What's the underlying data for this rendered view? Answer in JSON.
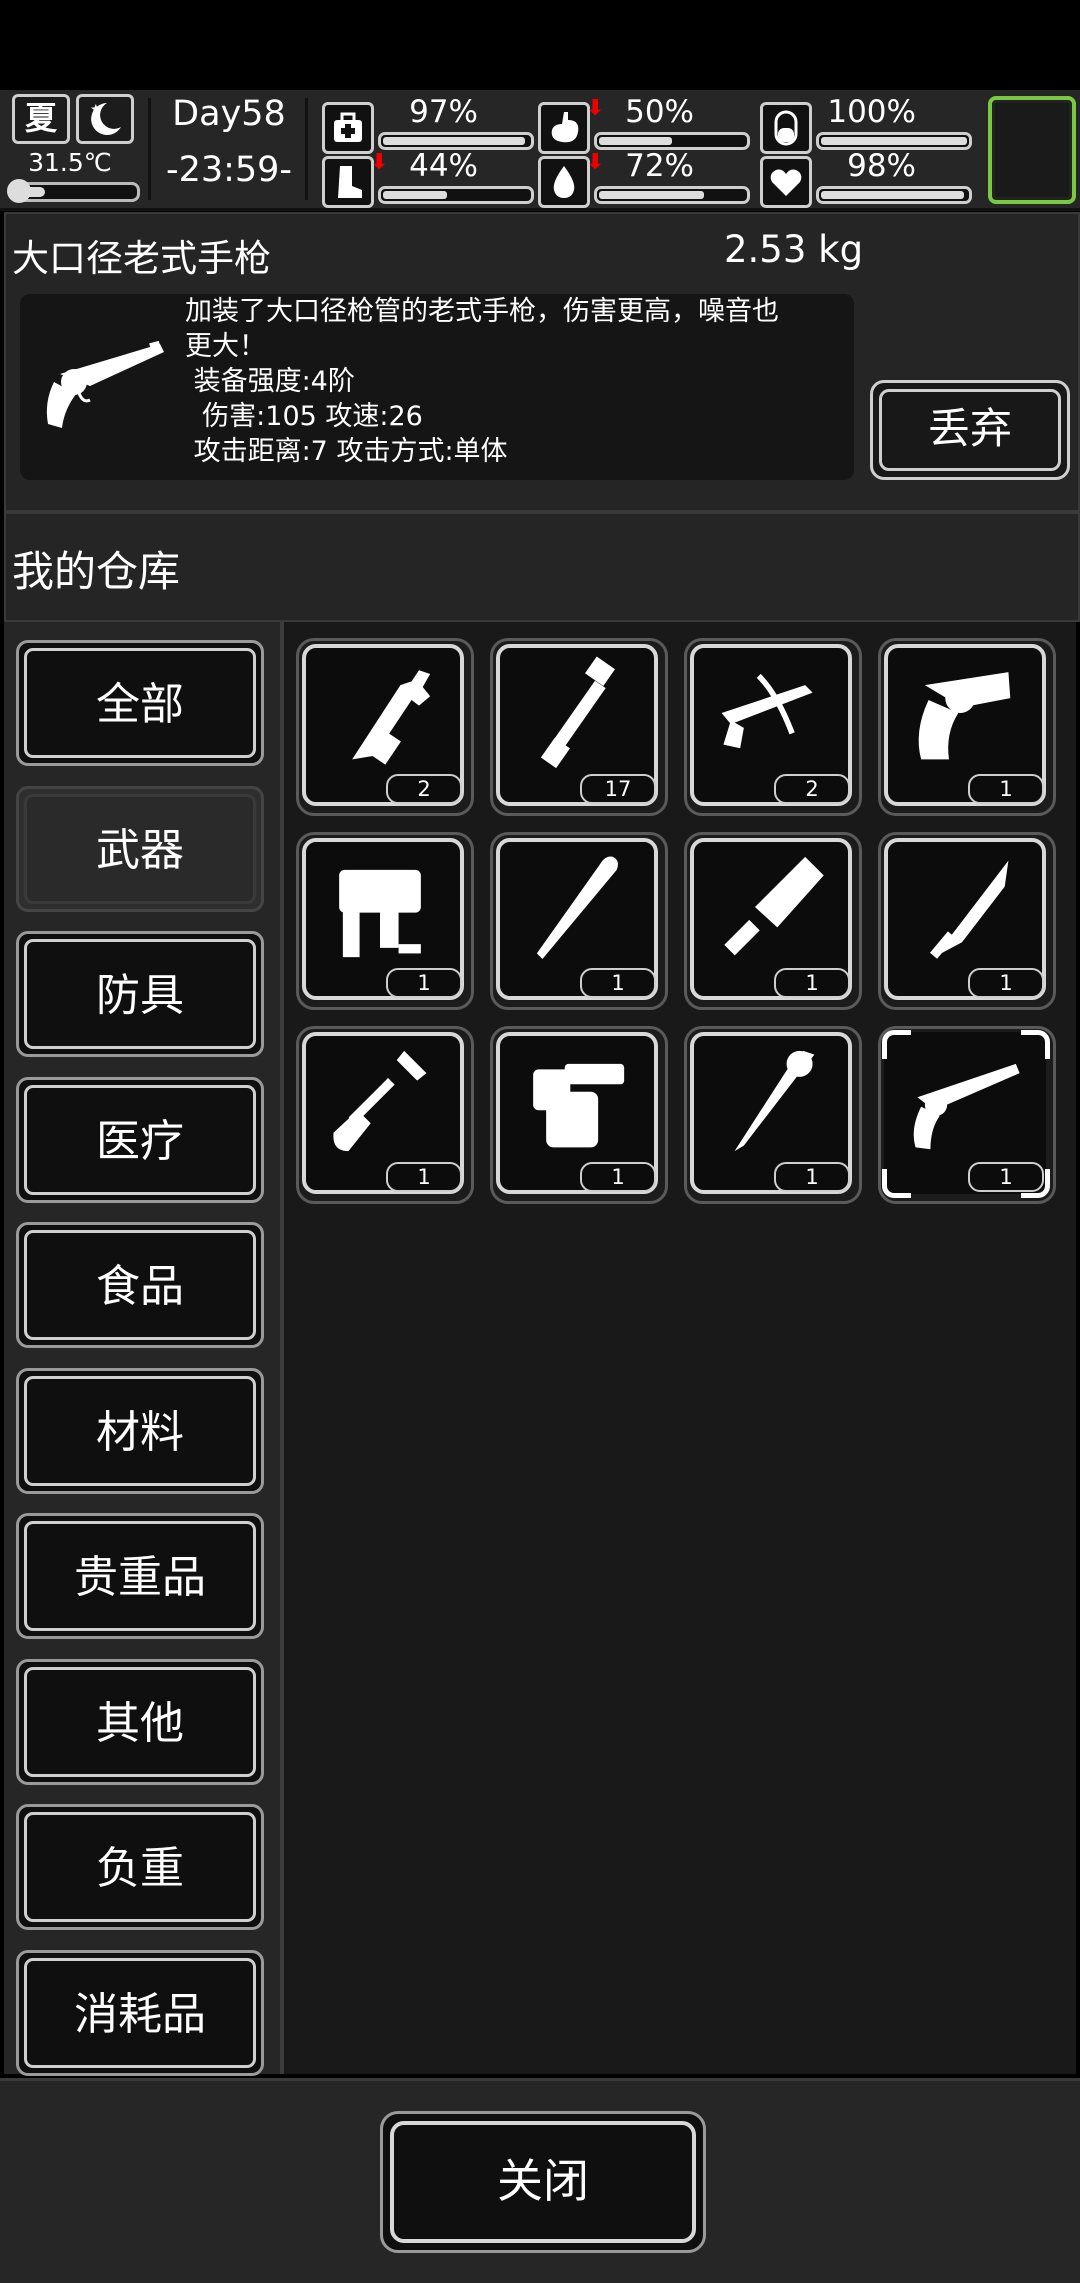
{
  "hud": {
    "season": "夏",
    "temperature": "31.5℃",
    "temperature_level": 0.25,
    "day": "Day58",
    "time": "-23:59-",
    "stats": [
      {
        "name": "health",
        "icon": "medkit-icon",
        "value": "97%",
        "level": 0.97,
        "decreasing": false
      },
      {
        "name": "hunger",
        "icon": "stomach-icon",
        "value": "50%",
        "level": 0.5,
        "decreasing": true
      },
      {
        "name": "mood",
        "icon": "pill-icon",
        "value": "100%",
        "level": 1.0,
        "decreasing": false
      },
      {
        "name": "stamina",
        "icon": "boot-icon",
        "value": "44%",
        "level": 0.44,
        "decreasing": true
      },
      {
        "name": "thirst",
        "icon": "water-drop-icon",
        "value": "72%",
        "level": 0.72,
        "decreasing": true
      },
      {
        "name": "heart",
        "icon": "heart-icon",
        "value": "98%",
        "level": 0.98,
        "decreasing": false
      }
    ]
  },
  "item": {
    "name": "大口径老式手枪",
    "weight": "2.53 kg",
    "icon": "revolver-icon",
    "description_line1": "加装了大口径枪管的老式手枪，伤害更高，噪音也",
    "description_line2": "更大！",
    "strength": " 装备强度:4阶",
    "damage_speed": "  伤害:105 攻速:26",
    "range_mode": " 攻击距离:7 攻击方式:单体",
    "drop_label": "丢弃"
  },
  "warehouse": {
    "title": "我的仓库",
    "categories": [
      "全部",
      "武器",
      "防具",
      "医疗",
      "食品",
      "材料",
      "贵重品",
      "其他",
      "负重",
      "消耗品"
    ],
    "active_category": "武器",
    "items": [
      {
        "icon": "multitool-wrench-icon",
        "count": "2"
      },
      {
        "icon": "pipe-club-icon",
        "count": "17"
      },
      {
        "icon": "crossbow-icon",
        "count": "2"
      },
      {
        "icon": "revolver-icon",
        "count": "1"
      },
      {
        "icon": "nail-gun-icon",
        "count": "1"
      },
      {
        "icon": "baseball-bat-icon",
        "count": "1"
      },
      {
        "icon": "cleaver-icon",
        "count": "1"
      },
      {
        "icon": "combat-knife-icon",
        "count": "1"
      },
      {
        "icon": "shovel-icon",
        "count": "1"
      },
      {
        "icon": "blowtorch-icon",
        "count": "1"
      },
      {
        "icon": "spiked-club-icon",
        "count": "1"
      },
      {
        "icon": "long-revolver-icon",
        "count": "1"
      }
    ],
    "selected_index": 11
  },
  "footer": {
    "close_label": "关闭"
  }
}
